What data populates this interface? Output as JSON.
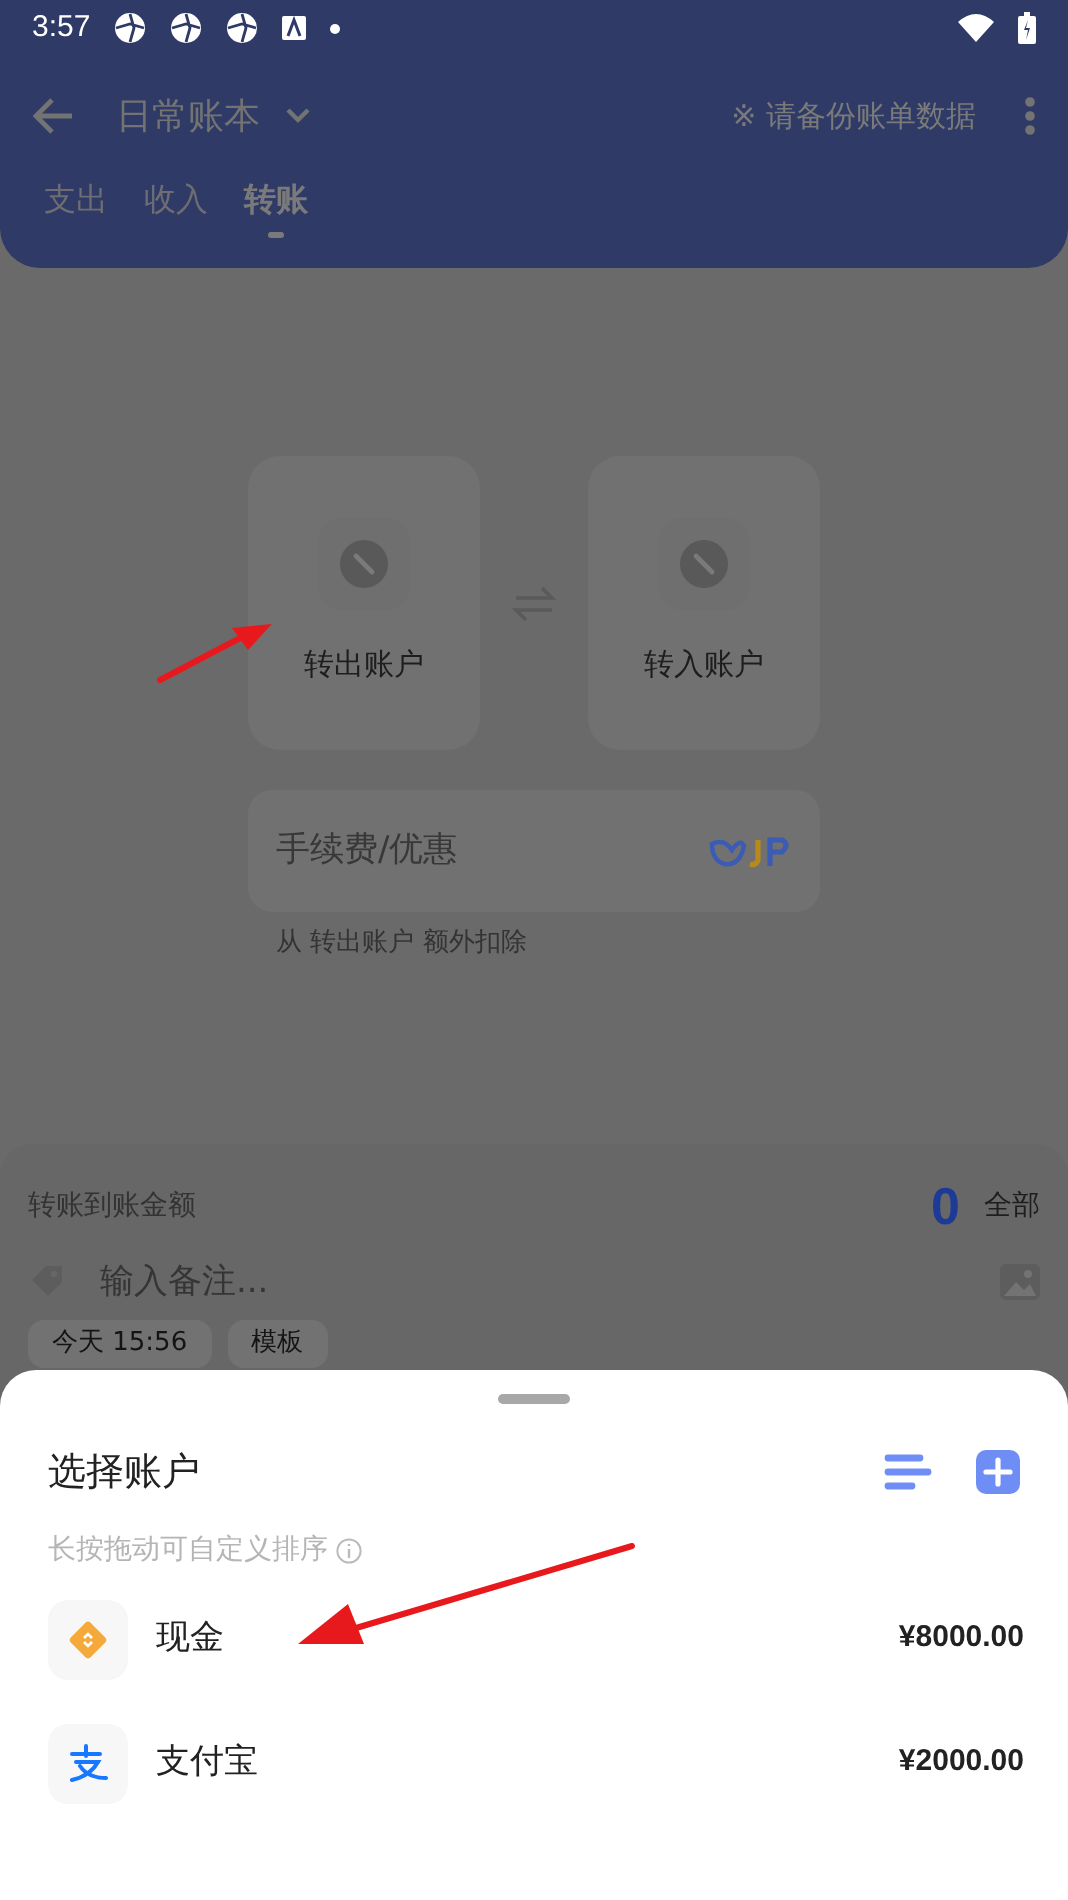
{
  "status_bar": {
    "time": "3:57"
  },
  "header": {
    "book": "日常账本",
    "backup_notice": "※ 请备份账单数据"
  },
  "tabs": [
    {
      "label": "支出",
      "selected": false
    },
    {
      "label": "收入",
      "selected": false
    },
    {
      "label": "转账",
      "selected": true
    }
  ],
  "transfer": {
    "from_label": "转出账户",
    "to_label": "转入账户",
    "fee_placeholder": "手续费/优惠",
    "fee_note": "从 转出账户 额外扣除"
  },
  "amount": {
    "label": "转账到账金额",
    "value": "0",
    "all": "全部",
    "note_placeholder": "输入备注...",
    "chips": [
      "今天 15:56",
      "模板"
    ]
  },
  "sheet": {
    "title": "选择账户",
    "hint": "长按拖动可自定义排序",
    "accounts": [
      {
        "kind": "cash",
        "name": "现金",
        "balance": "¥8000.00"
      },
      {
        "kind": "alipay",
        "name": "支付宝",
        "balance": "¥2000.00"
      }
    ]
  }
}
